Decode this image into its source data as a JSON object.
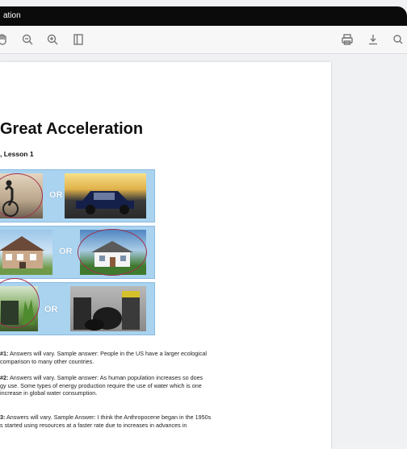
{
  "window": {
    "title": "ation"
  },
  "toolbar": {
    "icons": [
      "hand-icon",
      "zoom-out-icon",
      "zoom-in-icon",
      "sidebar-toggle-icon",
      "print-icon",
      "download-icon",
      "search-icon"
    ]
  },
  "document": {
    "heading": "Great Acceleration",
    "subheading": ", Lesson 1",
    "or_label": "OR",
    "answers": [
      {
        "prefix": "#1:",
        "text": " Answers will vary. Sample answer: People in the US have a larger ecological",
        "line2": "comparison to many other countries."
      },
      {
        "prefix": "#2:",
        "text": " Answers will vary. Sample answer: As human population increases so does",
        "line2": "gy use. Some types of energy production require the use of water which is one",
        "line3": "increase in global water consumption."
      },
      {
        "prefix": "3:",
        "text": " Answers will vary. Sample Answer: I think the Anthropocene began in the 1950s",
        "line2": "s started using resources at a faster rate due to increases in advances in"
      }
    ]
  },
  "colors": {
    "titlebar": "#0b0b0b",
    "row_bg": "#a9d3ef",
    "circle": "#a0304e"
  }
}
